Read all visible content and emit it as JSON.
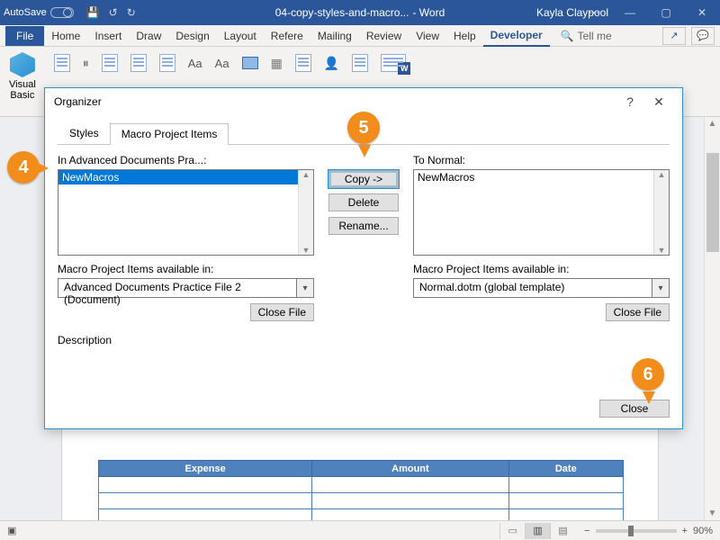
{
  "titlebar": {
    "autosave": "AutoSave",
    "doc_name": "04-copy-styles-and-macro...",
    "app_suffix": " - Word",
    "user": "Kayla Claypool",
    "min": "—",
    "restore": "▢",
    "close": "✕"
  },
  "tabs": {
    "file": "File",
    "items": [
      "Home",
      "Insert",
      "Draw",
      "Design",
      "Layout",
      "Refere",
      "Mailing",
      "Review",
      "View",
      "Help",
      "Developer"
    ],
    "active_index": 10,
    "tell_me": "Tell me"
  },
  "ribbon": {
    "visual_basic": "Visual\nBasic",
    "aa1": "Aa",
    "aa2": "Aa"
  },
  "dialog": {
    "title": "Organizer",
    "help": "?",
    "close_x": "✕",
    "tab_styles": "Styles",
    "tab_macro": "Macro Project Items",
    "left_label": "In Advanced Documents Pra...:",
    "right_label": "To Normal:",
    "left_item": "NewMacros",
    "right_item": "NewMacros",
    "copy": "Copy ->",
    "delete": "Delete",
    "rename": "Rename...",
    "avail_label": "Macro Project Items available in:",
    "left_combo": "Advanced Documents Practice File 2 (Document)",
    "right_combo": "Normal.dotm (global template)",
    "close_file": "Close File",
    "description": "Description",
    "close": "Close"
  },
  "table": {
    "h1": "Expense",
    "h2": "Amount",
    "h3": "Date"
  },
  "callouts": {
    "c4": "4",
    "c5": "5",
    "c6": "6"
  },
  "statusbar": {
    "zoom": "90%",
    "minus": "−",
    "plus": "+"
  }
}
